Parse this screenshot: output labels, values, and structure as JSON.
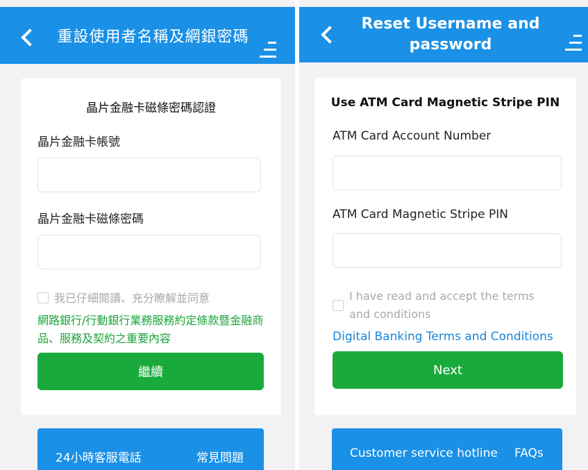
{
  "zh": {
    "header": {
      "title": "重設使用者名稱及網銀密碼"
    },
    "card": {
      "title": "晶片金融卡磁條密碼認證",
      "account_label": "晶片金融卡帳號",
      "account_value": "",
      "pin_label": "晶片金融卡磁條密碼",
      "pin_value": "",
      "agree_text": "我已仔細閱讀、充分瞭解並同意",
      "terms_link": "網路銀行/行動銀行業務服務約定條款暨金融商品、服務及契約之重要內容",
      "continue_button": "繼續"
    },
    "footer": {
      "hotline": "24小時客服電話",
      "faq": "常見問題"
    }
  },
  "en": {
    "header": {
      "title": "Reset Username and password"
    },
    "card": {
      "title": "Use ATM Card Magnetic Stripe PIN",
      "account_label": "ATM Card Account Number",
      "account_value": "",
      "pin_label": "ATM Card Magnetic Stripe PIN",
      "pin_value": "",
      "agree_text": "I have read and accept the terms and conditions",
      "terms_link": "Digital Banking Terms and Conditions",
      "next_button": "Next"
    },
    "footer": {
      "hotline": "Customer service hotline",
      "faq": "FAQs"
    }
  },
  "colors": {
    "header_blue": "#1a90e6",
    "button_green": "#1aaa3c",
    "terms_green": "#1aa33a",
    "link_blue": "#1a86d8",
    "page_background": "#f2f2f4"
  },
  "icons": {
    "back": "chevron-left-icon",
    "menu": "menu-icon"
  }
}
